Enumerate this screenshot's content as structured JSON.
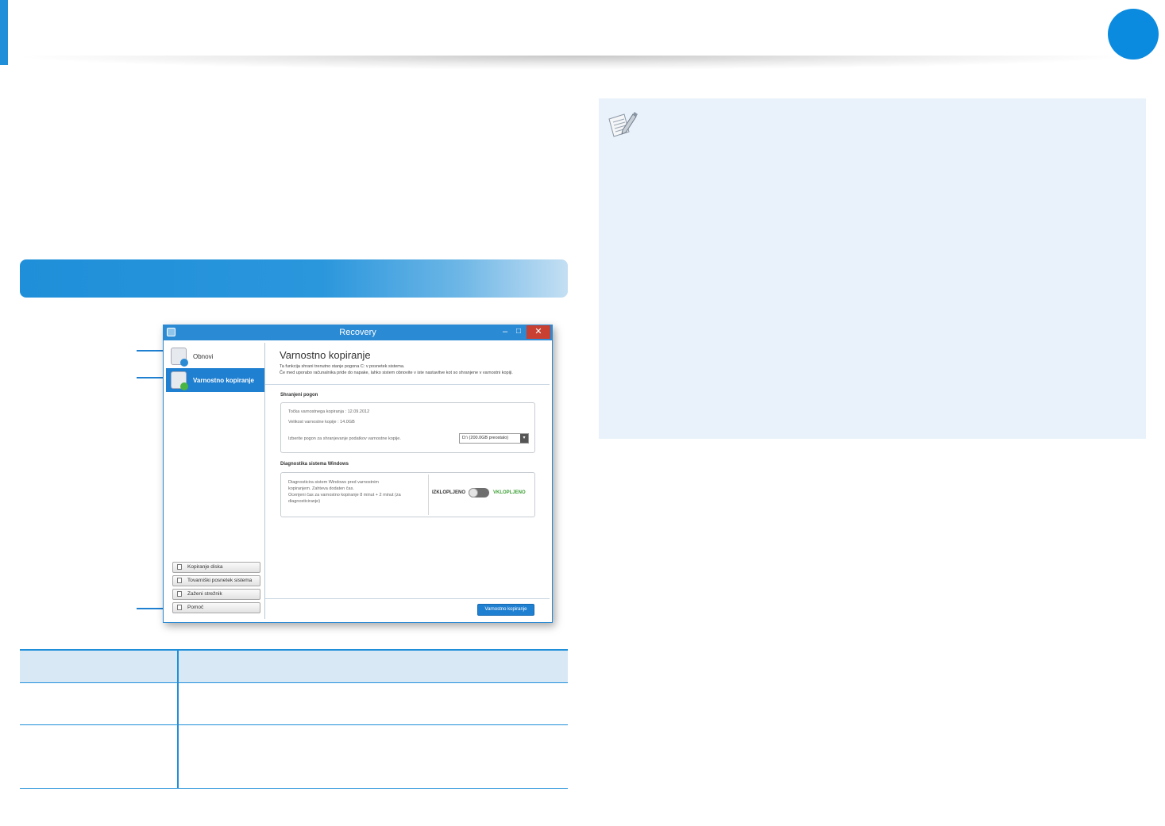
{
  "window": {
    "title": "Recovery",
    "controls": {
      "minimize": "–",
      "maximize": "□",
      "close": "✕"
    }
  },
  "sidebar": {
    "items": [
      {
        "label": "Obnovi"
      },
      {
        "label": "Varnostno kopiranje"
      }
    ],
    "buttons": [
      {
        "label": "Kopiranje diska"
      },
      {
        "label": "Tovarniški posnetek sistema"
      },
      {
        "label": "Zaženi strežnik"
      },
      {
        "label": "Pomoč"
      }
    ]
  },
  "main": {
    "title": "Varnostno kopiranje",
    "desc_line1": "Ta funkcija shrani trenutno stanje pogona C: v posnetek sistema.",
    "desc_line2": "Če med uporabo računalnika pride do napake, lahko sistem obnovite v iste nastavitve kot so shranjene v varnostni kopiji.",
    "storage": {
      "title": "Shranjeni pogon",
      "backup_point": "Točka varnostnega kopiranja : 12.09.2012",
      "backup_size": "Velikost varnostne kopije : 14.0GB",
      "select_label": "Izberite pogon za shranjevanje podatkov varnostne kopije.",
      "drive_value": "D:\\ (200.0GB preostalo)"
    },
    "diagnostics": {
      "title": "Diagnostika sistema Windows",
      "line1": "Diagnosticira sistem Windows pred varnostnim",
      "line2": "kopiranjem. Zahteva dodaten čas.",
      "line3": "Ocenjeni čas za varnostno kopiranje 8 minut + 2 minut (za",
      "line4": "diagnosticiranje)",
      "toggle_off": "IZKLOPLJENO",
      "toggle_on": "VKLOPLJENO",
      "toggle_state_on": false
    },
    "action_button": "Varnostno kopiranje"
  },
  "colors": {
    "accent": "#1f8fd9",
    "note_bg": "#e9f2fa",
    "toggle_on": "#3ca035",
    "close_button": "#c84031"
  }
}
